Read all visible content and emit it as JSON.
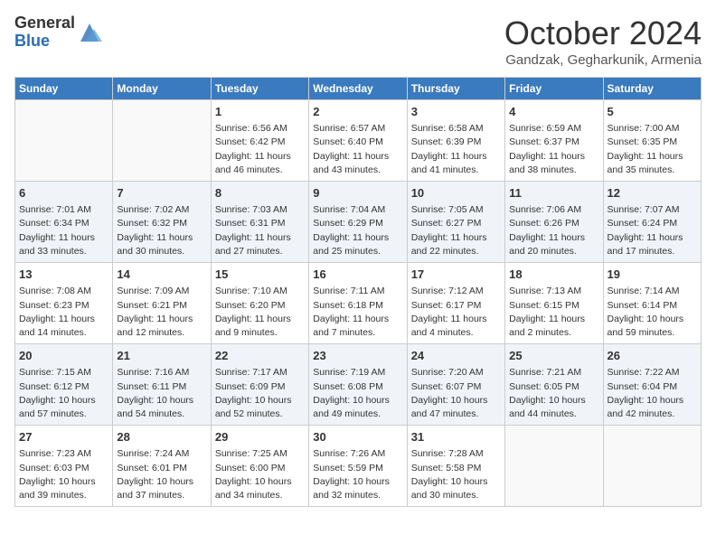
{
  "header": {
    "logo_general": "General",
    "logo_blue": "Blue",
    "month_title": "October 2024",
    "subtitle": "Gandzak, Gegharkunik, Armenia"
  },
  "days_of_week": [
    "Sunday",
    "Monday",
    "Tuesday",
    "Wednesday",
    "Thursday",
    "Friday",
    "Saturday"
  ],
  "weeks": [
    [
      {
        "day": "",
        "info": ""
      },
      {
        "day": "",
        "info": ""
      },
      {
        "day": "1",
        "info": "Sunrise: 6:56 AM\nSunset: 6:42 PM\nDaylight: 11 hours and 46 minutes."
      },
      {
        "day": "2",
        "info": "Sunrise: 6:57 AM\nSunset: 6:40 PM\nDaylight: 11 hours and 43 minutes."
      },
      {
        "day": "3",
        "info": "Sunrise: 6:58 AM\nSunset: 6:39 PM\nDaylight: 11 hours and 41 minutes."
      },
      {
        "day": "4",
        "info": "Sunrise: 6:59 AM\nSunset: 6:37 PM\nDaylight: 11 hours and 38 minutes."
      },
      {
        "day": "5",
        "info": "Sunrise: 7:00 AM\nSunset: 6:35 PM\nDaylight: 11 hours and 35 minutes."
      }
    ],
    [
      {
        "day": "6",
        "info": "Sunrise: 7:01 AM\nSunset: 6:34 PM\nDaylight: 11 hours and 33 minutes."
      },
      {
        "day": "7",
        "info": "Sunrise: 7:02 AM\nSunset: 6:32 PM\nDaylight: 11 hours and 30 minutes."
      },
      {
        "day": "8",
        "info": "Sunrise: 7:03 AM\nSunset: 6:31 PM\nDaylight: 11 hours and 27 minutes."
      },
      {
        "day": "9",
        "info": "Sunrise: 7:04 AM\nSunset: 6:29 PM\nDaylight: 11 hours and 25 minutes."
      },
      {
        "day": "10",
        "info": "Sunrise: 7:05 AM\nSunset: 6:27 PM\nDaylight: 11 hours and 22 minutes."
      },
      {
        "day": "11",
        "info": "Sunrise: 7:06 AM\nSunset: 6:26 PM\nDaylight: 11 hours and 20 minutes."
      },
      {
        "day": "12",
        "info": "Sunrise: 7:07 AM\nSunset: 6:24 PM\nDaylight: 11 hours and 17 minutes."
      }
    ],
    [
      {
        "day": "13",
        "info": "Sunrise: 7:08 AM\nSunset: 6:23 PM\nDaylight: 11 hours and 14 minutes."
      },
      {
        "day": "14",
        "info": "Sunrise: 7:09 AM\nSunset: 6:21 PM\nDaylight: 11 hours and 12 minutes."
      },
      {
        "day": "15",
        "info": "Sunrise: 7:10 AM\nSunset: 6:20 PM\nDaylight: 11 hours and 9 minutes."
      },
      {
        "day": "16",
        "info": "Sunrise: 7:11 AM\nSunset: 6:18 PM\nDaylight: 11 hours and 7 minutes."
      },
      {
        "day": "17",
        "info": "Sunrise: 7:12 AM\nSunset: 6:17 PM\nDaylight: 11 hours and 4 minutes."
      },
      {
        "day": "18",
        "info": "Sunrise: 7:13 AM\nSunset: 6:15 PM\nDaylight: 11 hours and 2 minutes."
      },
      {
        "day": "19",
        "info": "Sunrise: 7:14 AM\nSunset: 6:14 PM\nDaylight: 10 hours and 59 minutes."
      }
    ],
    [
      {
        "day": "20",
        "info": "Sunrise: 7:15 AM\nSunset: 6:12 PM\nDaylight: 10 hours and 57 minutes."
      },
      {
        "day": "21",
        "info": "Sunrise: 7:16 AM\nSunset: 6:11 PM\nDaylight: 10 hours and 54 minutes."
      },
      {
        "day": "22",
        "info": "Sunrise: 7:17 AM\nSunset: 6:09 PM\nDaylight: 10 hours and 52 minutes."
      },
      {
        "day": "23",
        "info": "Sunrise: 7:19 AM\nSunset: 6:08 PM\nDaylight: 10 hours and 49 minutes."
      },
      {
        "day": "24",
        "info": "Sunrise: 7:20 AM\nSunset: 6:07 PM\nDaylight: 10 hours and 47 minutes."
      },
      {
        "day": "25",
        "info": "Sunrise: 7:21 AM\nSunset: 6:05 PM\nDaylight: 10 hours and 44 minutes."
      },
      {
        "day": "26",
        "info": "Sunrise: 7:22 AM\nSunset: 6:04 PM\nDaylight: 10 hours and 42 minutes."
      }
    ],
    [
      {
        "day": "27",
        "info": "Sunrise: 7:23 AM\nSunset: 6:03 PM\nDaylight: 10 hours and 39 minutes."
      },
      {
        "day": "28",
        "info": "Sunrise: 7:24 AM\nSunset: 6:01 PM\nDaylight: 10 hours and 37 minutes."
      },
      {
        "day": "29",
        "info": "Sunrise: 7:25 AM\nSunset: 6:00 PM\nDaylight: 10 hours and 34 minutes."
      },
      {
        "day": "30",
        "info": "Sunrise: 7:26 AM\nSunset: 5:59 PM\nDaylight: 10 hours and 32 minutes."
      },
      {
        "day": "31",
        "info": "Sunrise: 7:28 AM\nSunset: 5:58 PM\nDaylight: 10 hours and 30 minutes."
      },
      {
        "day": "",
        "info": ""
      },
      {
        "day": "",
        "info": ""
      }
    ]
  ]
}
